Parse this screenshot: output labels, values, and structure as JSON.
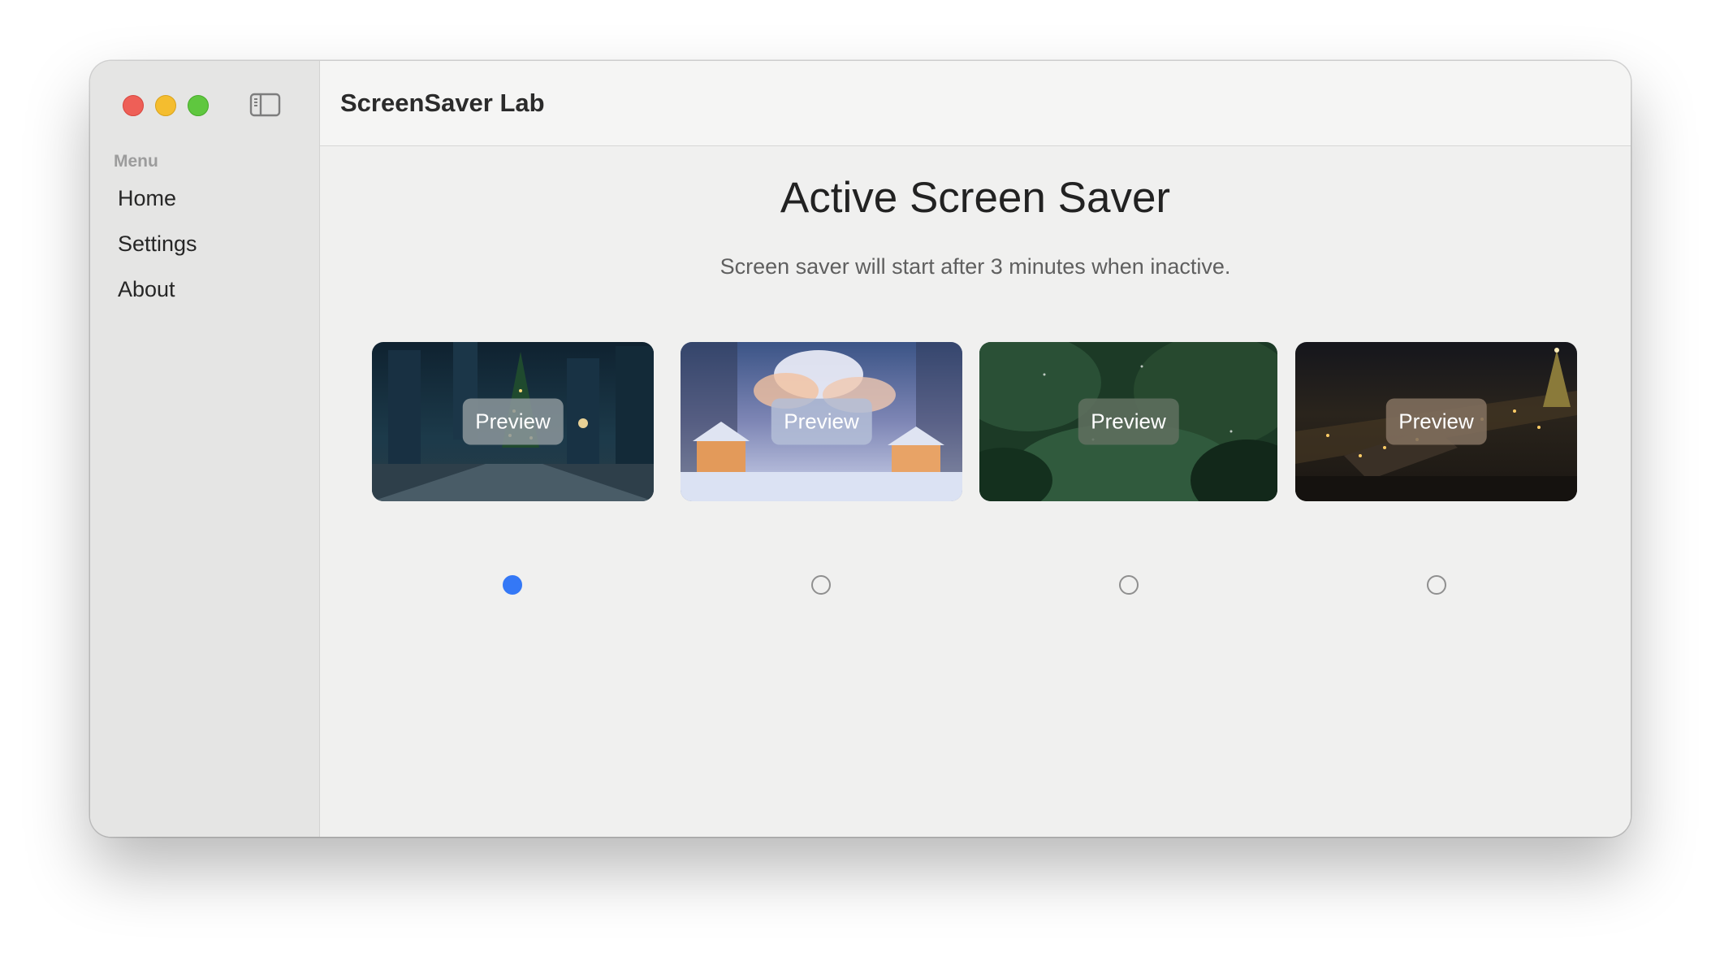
{
  "window": {
    "title": "ScreenSaver Lab",
    "traffic_lights": [
      "close",
      "minimize",
      "zoom"
    ]
  },
  "sidebar": {
    "toggle_icon": "sidebar-toggle-icon",
    "heading": "Menu",
    "items": [
      {
        "label": "Home"
      },
      {
        "label": "Settings"
      },
      {
        "label": "About"
      }
    ]
  },
  "main": {
    "heading": "Active Screen Saver",
    "subtitle": "Screen saver will start after 3 minutes when inactive.",
    "screensavers": [
      {
        "preview_label": "Preview",
        "scene": "city christmas tree at night",
        "selected": true
      },
      {
        "preview_label": "Preview",
        "scene": "snowy village under sunset clouds",
        "selected": false
      },
      {
        "preview_label": "Preview",
        "scene": "snow falling on pine branches",
        "selected": false
      },
      {
        "preview_label": "Preview",
        "scene": "aerial town lights with christmas tree",
        "selected": false
      }
    ]
  },
  "colors": {
    "accent": "#3478f6",
    "close": "#ee5f57",
    "minimize": "#f4bd2f",
    "zoom": "#5fc73f"
  }
}
